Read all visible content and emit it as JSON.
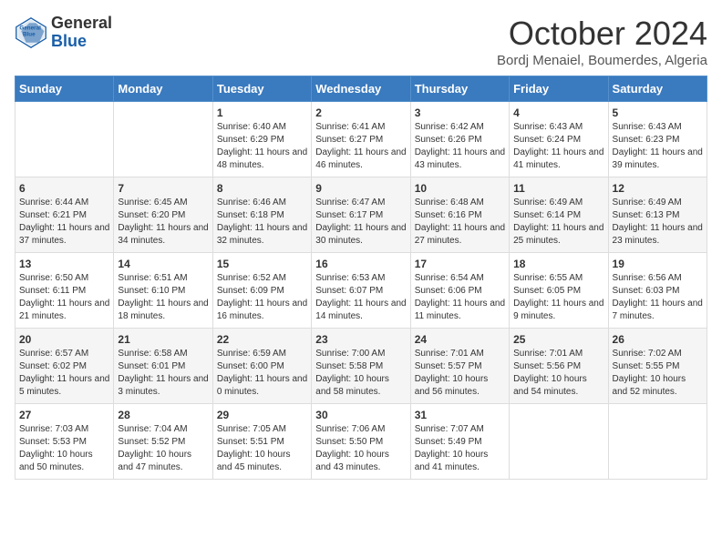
{
  "header": {
    "logo_line1": "General",
    "logo_line2": "Blue",
    "month": "October 2024",
    "location": "Bordj Menaiel, Boumerdes, Algeria"
  },
  "days_of_week": [
    "Sunday",
    "Monday",
    "Tuesday",
    "Wednesday",
    "Thursday",
    "Friday",
    "Saturday"
  ],
  "weeks": [
    [
      {
        "day": "",
        "content": ""
      },
      {
        "day": "",
        "content": ""
      },
      {
        "day": "1",
        "content": "Sunrise: 6:40 AM\nSunset: 6:29 PM\nDaylight: 11 hours and 48 minutes."
      },
      {
        "day": "2",
        "content": "Sunrise: 6:41 AM\nSunset: 6:27 PM\nDaylight: 11 hours and 46 minutes."
      },
      {
        "day": "3",
        "content": "Sunrise: 6:42 AM\nSunset: 6:26 PM\nDaylight: 11 hours and 43 minutes."
      },
      {
        "day": "4",
        "content": "Sunrise: 6:43 AM\nSunset: 6:24 PM\nDaylight: 11 hours and 41 minutes."
      },
      {
        "day": "5",
        "content": "Sunrise: 6:43 AM\nSunset: 6:23 PM\nDaylight: 11 hours and 39 minutes."
      }
    ],
    [
      {
        "day": "6",
        "content": "Sunrise: 6:44 AM\nSunset: 6:21 PM\nDaylight: 11 hours and 37 minutes."
      },
      {
        "day": "7",
        "content": "Sunrise: 6:45 AM\nSunset: 6:20 PM\nDaylight: 11 hours and 34 minutes."
      },
      {
        "day": "8",
        "content": "Sunrise: 6:46 AM\nSunset: 6:18 PM\nDaylight: 11 hours and 32 minutes."
      },
      {
        "day": "9",
        "content": "Sunrise: 6:47 AM\nSunset: 6:17 PM\nDaylight: 11 hours and 30 minutes."
      },
      {
        "day": "10",
        "content": "Sunrise: 6:48 AM\nSunset: 6:16 PM\nDaylight: 11 hours and 27 minutes."
      },
      {
        "day": "11",
        "content": "Sunrise: 6:49 AM\nSunset: 6:14 PM\nDaylight: 11 hours and 25 minutes."
      },
      {
        "day": "12",
        "content": "Sunrise: 6:49 AM\nSunset: 6:13 PM\nDaylight: 11 hours and 23 minutes."
      }
    ],
    [
      {
        "day": "13",
        "content": "Sunrise: 6:50 AM\nSunset: 6:11 PM\nDaylight: 11 hours and 21 minutes."
      },
      {
        "day": "14",
        "content": "Sunrise: 6:51 AM\nSunset: 6:10 PM\nDaylight: 11 hours and 18 minutes."
      },
      {
        "day": "15",
        "content": "Sunrise: 6:52 AM\nSunset: 6:09 PM\nDaylight: 11 hours and 16 minutes."
      },
      {
        "day": "16",
        "content": "Sunrise: 6:53 AM\nSunset: 6:07 PM\nDaylight: 11 hours and 14 minutes."
      },
      {
        "day": "17",
        "content": "Sunrise: 6:54 AM\nSunset: 6:06 PM\nDaylight: 11 hours and 11 minutes."
      },
      {
        "day": "18",
        "content": "Sunrise: 6:55 AM\nSunset: 6:05 PM\nDaylight: 11 hours and 9 minutes."
      },
      {
        "day": "19",
        "content": "Sunrise: 6:56 AM\nSunset: 6:03 PM\nDaylight: 11 hours and 7 minutes."
      }
    ],
    [
      {
        "day": "20",
        "content": "Sunrise: 6:57 AM\nSunset: 6:02 PM\nDaylight: 11 hours and 5 minutes."
      },
      {
        "day": "21",
        "content": "Sunrise: 6:58 AM\nSunset: 6:01 PM\nDaylight: 11 hours and 3 minutes."
      },
      {
        "day": "22",
        "content": "Sunrise: 6:59 AM\nSunset: 6:00 PM\nDaylight: 11 hours and 0 minutes."
      },
      {
        "day": "23",
        "content": "Sunrise: 7:00 AM\nSunset: 5:58 PM\nDaylight: 10 hours and 58 minutes."
      },
      {
        "day": "24",
        "content": "Sunrise: 7:01 AM\nSunset: 5:57 PM\nDaylight: 10 hours and 56 minutes."
      },
      {
        "day": "25",
        "content": "Sunrise: 7:01 AM\nSunset: 5:56 PM\nDaylight: 10 hours and 54 minutes."
      },
      {
        "day": "26",
        "content": "Sunrise: 7:02 AM\nSunset: 5:55 PM\nDaylight: 10 hours and 52 minutes."
      }
    ],
    [
      {
        "day": "27",
        "content": "Sunrise: 7:03 AM\nSunset: 5:53 PM\nDaylight: 10 hours and 50 minutes."
      },
      {
        "day": "28",
        "content": "Sunrise: 7:04 AM\nSunset: 5:52 PM\nDaylight: 10 hours and 47 minutes."
      },
      {
        "day": "29",
        "content": "Sunrise: 7:05 AM\nSunset: 5:51 PM\nDaylight: 10 hours and 45 minutes."
      },
      {
        "day": "30",
        "content": "Sunrise: 7:06 AM\nSunset: 5:50 PM\nDaylight: 10 hours and 43 minutes."
      },
      {
        "day": "31",
        "content": "Sunrise: 7:07 AM\nSunset: 5:49 PM\nDaylight: 10 hours and 41 minutes."
      },
      {
        "day": "",
        "content": ""
      },
      {
        "day": "",
        "content": ""
      }
    ]
  ]
}
